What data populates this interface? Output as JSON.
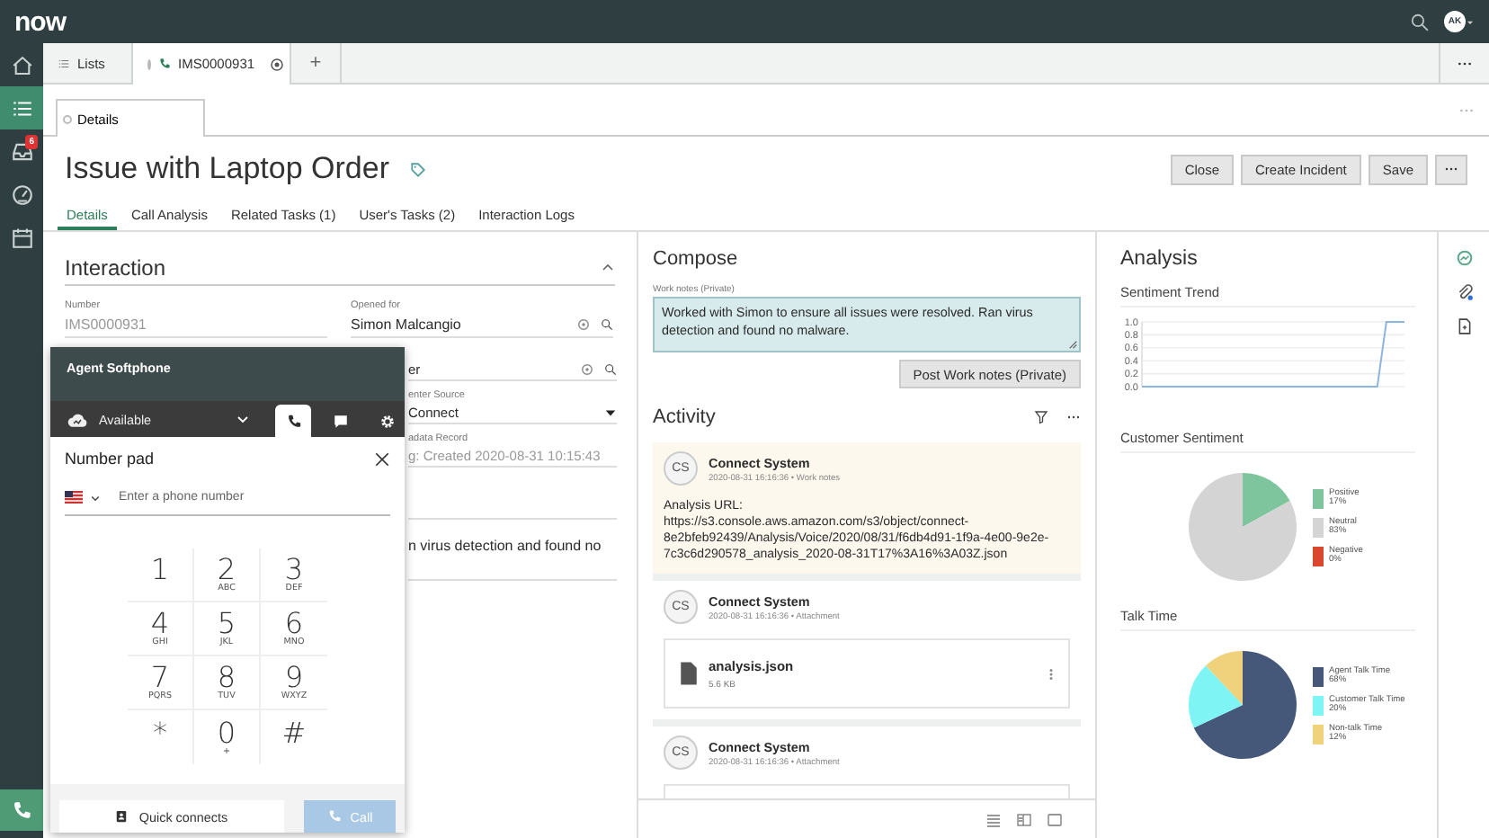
{
  "top_bar": {
    "logo": "now",
    "avatar": "AK"
  },
  "rail": {
    "items": [
      {
        "kind": "home",
        "selected": false
      },
      {
        "kind": "list",
        "selected": true
      },
      {
        "kind": "inbox",
        "selected": false,
        "badge": "6"
      },
      {
        "kind": "gauge",
        "selected": false
      },
      {
        "kind": "calendar",
        "selected": false
      }
    ]
  },
  "tabs": [
    {
      "label": "Lists",
      "kind": "list",
      "selected": false
    },
    {
      "label": "IMS0000931",
      "kind": "call",
      "selected": true
    }
  ],
  "new_tab": "+",
  "subtabs": [
    {
      "label": "Details",
      "selected": true
    }
  ],
  "record": {
    "title": "Issue with Laptop Order",
    "buttons": [
      "Close",
      "Create Incident",
      "Save"
    ]
  },
  "nav_tabs": [
    {
      "label": "Details",
      "selected": true
    },
    {
      "label": "Call Analysis",
      "selected": false
    },
    {
      "label": "Related Tasks (1)",
      "selected": false
    },
    {
      "label": "User's Tasks (2)",
      "selected": false
    },
    {
      "label": "Interaction Logs",
      "selected": false
    }
  ],
  "interaction": {
    "heading": "Interaction",
    "expanded": true,
    "fields": [
      {
        "label": "Number",
        "value": "IMS0000931",
        "kind": "readonly"
      },
      {
        "label": "Opened for",
        "value": "Simon Malcangio",
        "kind": "reference"
      }
    ],
    "partial_fields": [
      {
        "value": "er",
        "kind": "reference"
      },
      {
        "label": "enter Source",
        "value": "Connect",
        "kind": "choice"
      },
      {
        "label": "adata Record",
        "value": "g: Created 2020-08-31 10:15:43",
        "kind": "readonly"
      }
    ],
    "partial_text": "n virus detection and found no"
  },
  "softphone": {
    "title": "Agent Softphone",
    "status": "Available",
    "tools": [
      {
        "kind": "phone",
        "selected": true
      },
      {
        "kind": "chat",
        "selected": false
      },
      {
        "kind": "settings",
        "selected": false
      }
    ],
    "pad_title": "Number pad",
    "phone_placeholder": "Enter a phone number",
    "keys": [
      {
        "digit": "1"
      },
      {
        "digit": "2",
        "letters": "ABC"
      },
      {
        "digit": "3",
        "letters": "DEF"
      },
      {
        "digit": "4",
        "letters": "GHI"
      },
      {
        "digit": "5",
        "letters": "JKL"
      },
      {
        "digit": "6",
        "letters": "MNO"
      },
      {
        "digit": "7",
        "letters": "PQRS"
      },
      {
        "digit": "8",
        "letters": "TUV"
      },
      {
        "digit": "9",
        "letters": "WXYZ"
      },
      {
        "digit": "*"
      },
      {
        "digit": "0",
        "letters": "+"
      },
      {
        "digit": "#"
      }
    ],
    "quick_connects": "Quick connects",
    "call": {
      "label": "Call",
      "disabled": true
    }
  },
  "compose": {
    "heading": "Compose",
    "work_notes": {
      "label": "Work notes (Private)",
      "value": "Worked with Simon to ensure all issues were resolved. Ran virus detection and found no malware."
    },
    "post_button": "Post Work notes (Private)"
  },
  "activity": {
    "heading": "Activity",
    "entries": [
      {
        "kind": "work_notes",
        "author": "Connect System",
        "initials": "CS",
        "meta": "2020-08-31 16:16:36 • Work notes",
        "lines": [
          "Analysis URL:",
          "https://s3.console.aws.amazon.com/s3/object/connect-8e2bfeb92439/Analysis/Voice/2020/08/31/f6db4d91-1f9a-4e00-9e2e-7c3c6d290578_analysis_2020-08-31T17%3A16%3A03Z.json"
        ]
      },
      {
        "kind": "attachment",
        "author": "Connect System",
        "initials": "CS",
        "meta": "2020-08-31 16:16:36 • Attachment",
        "file": {
          "name": "analysis.json",
          "size": "5.6 KB"
        }
      },
      {
        "kind": "attachment",
        "author": "Connect System",
        "initials": "CS",
        "meta": "2020-08-31 16:16:36 • Attachment"
      }
    ]
  },
  "analysis": {
    "heading": "Analysis",
    "trend": {
      "title": "Sentiment Trend",
      "chart_data": {
        "type": "line",
        "values": [
          0,
          0,
          0,
          0,
          0,
          0,
          0,
          0,
          0,
          0,
          0,
          0,
          0,
          0,
          0,
          0,
          0,
          0,
          0,
          0,
          0,
          0,
          0,
          0,
          0,
          0,
          0,
          1,
          1,
          1
        ],
        "grid": true,
        "ylim": [
          0,
          1
        ],
        "yticks": [
          {
            "value": 0,
            "label": "0.0"
          },
          {
            "value": 0.2,
            "label": "0.2"
          },
          {
            "value": 0.4,
            "label": "0.4"
          },
          {
            "value": 0.6,
            "label": "0.6"
          },
          {
            "value": 0.8,
            "label": "0.8"
          },
          {
            "value": 1,
            "label": "1.0"
          }
        ]
      }
    },
    "sentiment": {
      "title": "Customer Sentiment",
      "chart_data": {
        "type": "pie",
        "categories": [
          "Positive",
          "Neutral",
          "Negative"
        ],
        "values": [
          17,
          83,
          0
        ],
        "legend": "right"
      },
      "legend": [
        {
          "percent": "17%",
          "color": "#7ec59e"
        },
        {
          "percent": "83%",
          "color": "#d4d4d4"
        },
        {
          "percent": "0%",
          "color": "#d9472f"
        }
      ]
    },
    "talk_time": {
      "title": "Talk Time",
      "chart_data": {
        "type": "pie",
        "categories": [
          "Agent Talk Time",
          "Customer Talk Time",
          "Non-talk Time"
        ],
        "values": [
          68,
          20,
          12
        ],
        "legend": "right"
      },
      "legend": [
        {
          "percent": "68%",
          "color": "#45587a"
        },
        {
          "percent": "20%",
          "color": "#7ef4f4"
        },
        {
          "percent": "12%",
          "color": "#f0d27d"
        }
      ]
    }
  }
}
